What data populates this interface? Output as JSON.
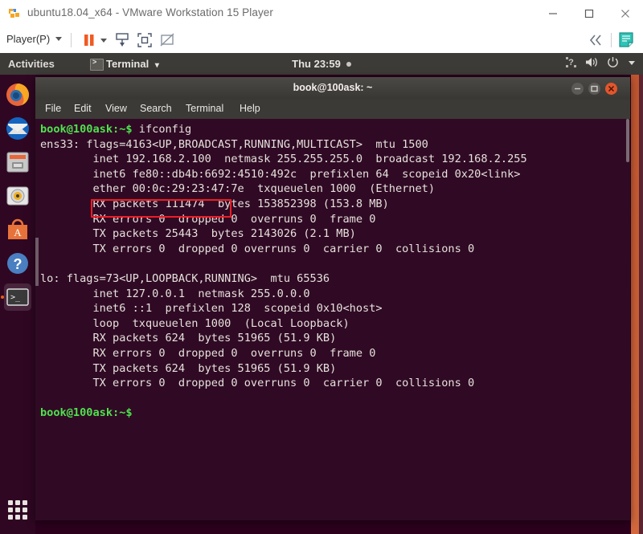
{
  "vmware": {
    "title": "ubuntu18.04_x64 - VMware Workstation 15 Player",
    "app_icon": "vmware-logo-icon",
    "window_controls": {
      "minimize": "minimize-icon",
      "maximize": "maximize-icon",
      "close": "close-icon"
    },
    "toolbar": {
      "player_menu": "Player(P)",
      "pause_label": "pause-icon",
      "dropdown_label": "chevron-down-icon",
      "send_keys_label": "send-ctrl-alt-del-icon",
      "unity_label": "unity-mode-icon",
      "no_display_label": "detach-display-icon",
      "collapse_label": "<<",
      "notes_label": "notes-icon"
    }
  },
  "ubuntu": {
    "topbar": {
      "activities": "Activities",
      "app_menu_icon": "terminal-icon",
      "app_menu": "Terminal",
      "app_menu_arrow": "▾",
      "clock": "Thu 23:59",
      "recording_dot": "status-dot",
      "input_icon": "keyboard-input-icon",
      "volume_icon": "volume-icon",
      "power_icon": "power-icon",
      "menu_arrow_icon": "chevron-down-icon"
    },
    "dock": {
      "items": [
        {
          "name": "firefox",
          "label": "Firefox"
        },
        {
          "name": "thunderbird",
          "label": "Thunderbird Mail"
        },
        {
          "name": "files",
          "label": "Files"
        },
        {
          "name": "rhythmbox",
          "label": "Rhythmbox"
        },
        {
          "name": "ubuntu-software",
          "label": "Ubuntu Software"
        },
        {
          "name": "help",
          "label": "Help"
        },
        {
          "name": "terminal",
          "label": "Terminal"
        }
      ],
      "show_apps": "show-applications-grid"
    }
  },
  "terminal": {
    "title": "book@100ask: ~",
    "controls": {
      "minimize": "minimize-icon",
      "maximize": "maximize-icon",
      "close": "close-icon"
    },
    "menu": [
      "File",
      "Edit",
      "View",
      "Search",
      "Terminal",
      "Help"
    ],
    "prompt": "book@100ask:~$",
    "command": " ifconfig",
    "lines": [
      "ens33: flags=4163<UP,BROADCAST,RUNNING,MULTICAST>  mtu 1500",
      "        inet 192.168.2.100  netmask 255.255.255.0  broadcast 192.168.2.255",
      "        inet6 fe80::db4b:6692:4510:492c  prefixlen 64  scopeid 0x20<link>",
      "        ether 00:0c:29:23:47:7e  txqueuelen 1000  (Ethernet)",
      "        RX packets 111474  bytes 153852398 (153.8 MB)",
      "        RX errors 0  dropped 0  overruns 0  frame 0",
      "        TX packets 25443  bytes 2143026 (2.1 MB)",
      "        TX errors 0  dropped 0 overruns 0  carrier 0  collisions 0",
      "",
      "lo: flags=73<UP,LOOPBACK,RUNNING>  mtu 65536",
      "        inet 127.0.0.1  netmask 255.0.0.0",
      "        inet6 ::1  prefixlen 128  scopeid 0x10<host>",
      "        loop  txqueuelen 1000  (Local Loopback)",
      "        RX packets 624  bytes 51965 (51.9 KB)",
      "        RX errors 0  dropped 0  overruns 0  frame 0",
      "        TX packets 624  bytes 51965 (51.9 KB)",
      "        TX errors 0  dropped 0 overruns 0  carrier 0  collisions 0",
      ""
    ],
    "final_prompt": "book@100ask:~$",
    "highlight": {
      "text": "inet 192.168.2.100",
      "color": "#ee1c24"
    }
  },
  "colors": {
    "terminal_bg": "#300a24",
    "desktop_bg": "#2c001e",
    "topbar_bg": "#3c3b37",
    "prompt_green": "#4ee24e",
    "close_orange": "#e2562c",
    "highlight_red": "#ee1c24",
    "vmware_accent": "#e8622a"
  }
}
